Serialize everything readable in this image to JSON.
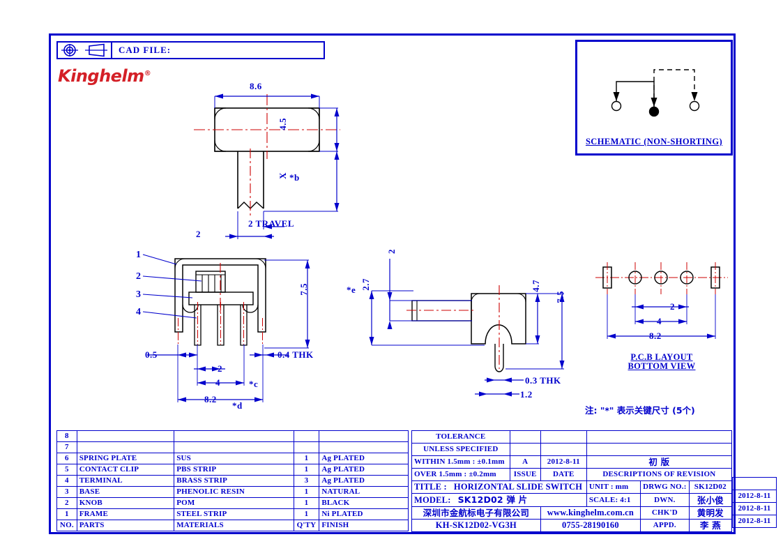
{
  "header": {
    "cad_file_label": "CAD  FILE:",
    "projection_icon": "first-angle-projection-icon",
    "cone_icon": "truncated-cone-icon",
    "logo_text": "Kinghelm",
    "logo_registered": "®"
  },
  "schematic": {
    "caption": "SCHEMATIC  (NON-SHORTING)",
    "terminals": [
      "open",
      "filled",
      "open"
    ]
  },
  "views": {
    "top_view": {
      "dims": {
        "width": "8.6",
        "height": "4.5",
        "knob_travel_height": "X",
        "key_mark_b": "*b",
        "knob_width": "2",
        "travel": "2  TRAVEL"
      }
    },
    "front_view": {
      "callouts": [
        "1",
        "2",
        "3",
        "4"
      ],
      "dims": {
        "edge_offset": "0.5",
        "pin_pitch": "2",
        "pin_span": "4",
        "key_mark_c": "*c",
        "total_width": "8.2",
        "key_mark_d": "*d",
        "height": "7.5",
        "thickness": "0.4  THK"
      }
    },
    "side_view": {
      "dims": {
        "actuator_thk": "2",
        "actuator_height": "2.7",
        "key_mark_e": "*e",
        "body_height": "4.7",
        "total_height": "7.5",
        "pin_thk": "0.3  THK",
        "pin_width": "1.2"
      }
    },
    "pcb_layout": {
      "caption_line1": "P.C.B  LAYOUT",
      "caption_line2": "BOTTOM  VIEW",
      "dims": {
        "hole_pitch": "2",
        "hole_span": "4",
        "total_span": "8.2"
      }
    }
  },
  "note": "注:  \"*\" 表示关键尺寸 (5个)",
  "bom": {
    "columns": [
      "NO.",
      "PARTS",
      "MATERIALS",
      "Q'TY",
      "FINISH"
    ],
    "rows": [
      {
        "no": "8",
        "part": "",
        "material": "",
        "qty": "",
        "finish": ""
      },
      {
        "no": "7",
        "part": "",
        "material": "",
        "qty": "",
        "finish": ""
      },
      {
        "no": "6",
        "part": "SPRING  PLATE",
        "material": "SUS",
        "qty": "1",
        "finish": "Ag  PLATED"
      },
      {
        "no": "5",
        "part": "CONTACT  CLIP",
        "material": "PBS  STRIP",
        "qty": "1",
        "finish": "Ag  PLATED"
      },
      {
        "no": "4",
        "part": "TERMINAL",
        "material": "BRASS  STRIP",
        "qty": "3",
        "finish": "Ag  PLATED"
      },
      {
        "no": "3",
        "part": "BASE",
        "material": "PHENOLIC  RESIN",
        "qty": "1",
        "finish": "NATURAL"
      },
      {
        "no": "2",
        "part": "KNOB",
        "material": "POM",
        "qty": "1",
        "finish": "BLACK"
      },
      {
        "no": "1",
        "part": "FRAME",
        "material": "STEEL  STRIP",
        "qty": "1",
        "finish": "Ni  PLATED"
      }
    ]
  },
  "title_block": {
    "tolerance_line1": "TOLERANCE",
    "tolerance_line2": "UNLESS   SPECIFIED",
    "tol_within": "WITHIN 1.5mm : ±0.1mm",
    "tol_over": "OVER 1.5mm : ±0.2mm",
    "issue_value": "A",
    "issue_label": "ISSUE",
    "date_value": "2012-8-11",
    "date_label": "DATE",
    "revision_desc_cn": "初  版",
    "revision_label": "DESCRIPTIONS  OF  REVISION",
    "title_label": "TITLE :",
    "title_value": "HORIZONTAL  SLIDE  SWITCH",
    "model_label": "MODEL:",
    "model_value": "SK12D02 弹 片",
    "company_cn": "深圳市金航标电子有限公司",
    "part_number": "KH-SK12D02-VG3H",
    "website": "www.kinghelm.com.cn",
    "phone": "0755-28190160",
    "unit_label": "UNIT :   mm",
    "scale_label": "SCALE:   4:1",
    "drwg_no_label": "DRWG NO.:",
    "drwg_no_value": "SK12D02",
    "dwn_label": "DWN.",
    "dwn_name": "张小俊",
    "dwn_date": "2012-8-11",
    "chkd_label": "CHK'D",
    "chkd_name": "黄明发",
    "chkd_date": "2012-8-11",
    "appd_label": "APPD.",
    "appd_name": "李 燕",
    "appd_date": "2012-8-11"
  },
  "colors": {
    "line_blue": "#0000cc",
    "logo_red": "#d42027",
    "centerline_red": "#cc0000",
    "part_black": "#000000"
  }
}
